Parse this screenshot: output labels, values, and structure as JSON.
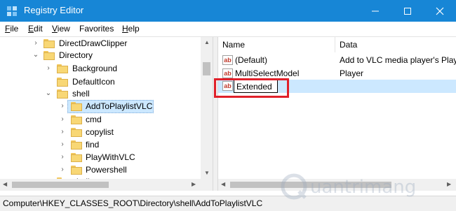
{
  "window": {
    "title": "Registry Editor"
  },
  "menu": [
    {
      "first": "F",
      "rest": "ile"
    },
    {
      "first": "E",
      "rest": "dit"
    },
    {
      "first": "V",
      "rest": "iew"
    },
    {
      "first": "",
      "rest": "Favorites"
    },
    {
      "first": "H",
      "rest": "elp"
    }
  ],
  "tree": {
    "items": [
      {
        "label": "DirectDrawClipper",
        "expander": "›",
        "selected": false
      },
      {
        "label": "Directory",
        "expander": "⌄",
        "selected": false
      },
      {
        "label": "Background",
        "expander": "›",
        "selected": false
      },
      {
        "label": "DefaultIcon",
        "expander": "",
        "selected": false
      },
      {
        "label": "shell",
        "expander": "⌄",
        "selected": false
      },
      {
        "label": "AddToPlaylistVLC",
        "expander": "›",
        "selected": true
      },
      {
        "label": "cmd",
        "expander": "›",
        "selected": false
      },
      {
        "label": "copylist",
        "expander": "›",
        "selected": false
      },
      {
        "label": "find",
        "expander": "›",
        "selected": false
      },
      {
        "label": "PlayWithVLC",
        "expander": "›",
        "selected": false
      },
      {
        "label": "Powershell",
        "expander": "›",
        "selected": false
      },
      {
        "label": "shellex",
        "expander": "›",
        "selected": false
      }
    ]
  },
  "values": {
    "columns": {
      "name": "Name",
      "data": "Data"
    },
    "rows": [
      {
        "name": "(Default)",
        "data": "Add to VLC media player's Playlist"
      },
      {
        "name": "MultiSelectModel",
        "data": "Player"
      }
    ],
    "editing": {
      "value": "Extended"
    }
  },
  "status": {
    "path": "Computer\\HKEY_CLASSES_ROOT\\Directory\\shell\\AddToPlaylistVLC"
  },
  "watermark": {
    "text": "uantrimang"
  },
  "colors": {
    "titlebar": "#1786d6",
    "highlight": "#cce8ff",
    "annotation": "#e0202a"
  }
}
